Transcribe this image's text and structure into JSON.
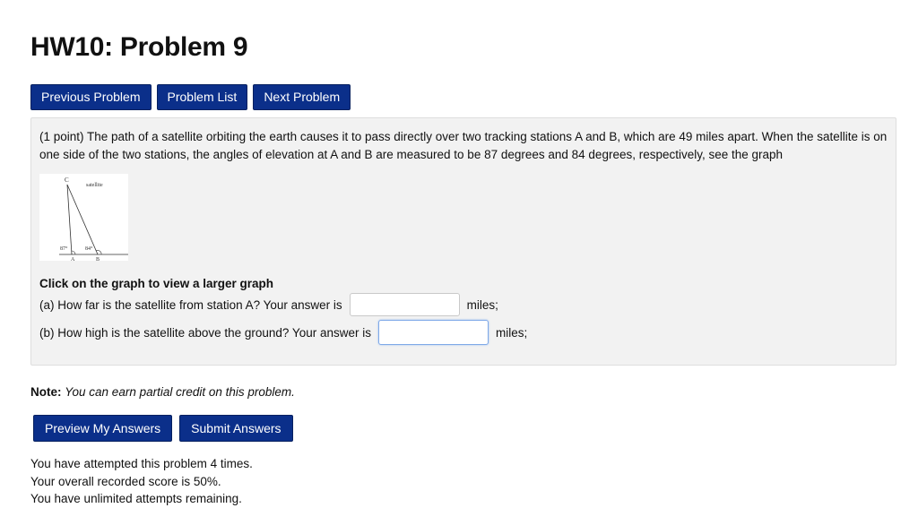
{
  "page_title": "HW10: Problem 9",
  "nav": {
    "previous": "Previous Problem",
    "list": "Problem List",
    "next": "Next Problem"
  },
  "problem": {
    "text": "(1 point) The path of a satellite orbiting the earth causes it to pass directly over two tracking stations A and B, which are 49 miles apart. When the satellite is on one side of the two stations, the angles of elevation at A and B are measured to be 87 degrees and 84 degrees, respectively, see the graph",
    "graph": {
      "label_c": "C",
      "label_satellite": "satellite",
      "angle_a": "87°",
      "angle_b": "84°",
      "label_a": "A",
      "label_b": "B"
    },
    "click_note": "Click on the graph to view a larger graph",
    "question_a": {
      "label": "(a) How far is the satellite from station A? Your answer is",
      "value": "",
      "unit": "miles;"
    },
    "question_b": {
      "label": "(b) How high is the satellite above the ground? Your answer is",
      "value": "",
      "unit": "miles;"
    }
  },
  "note": {
    "label": "Note:",
    "text": "You can earn partial credit on this problem."
  },
  "actions": {
    "preview": "Preview My Answers",
    "submit": "Submit Answers"
  },
  "status": {
    "attempts": "You have attempted this problem 4 times.",
    "score": "Your overall recorded score is 50%.",
    "remaining": "You have unlimited attempts remaining."
  },
  "colors": {
    "button_bg": "#0b2f8a",
    "panel_bg": "#f2f2f2",
    "focus_border": "#7fa9e8"
  }
}
